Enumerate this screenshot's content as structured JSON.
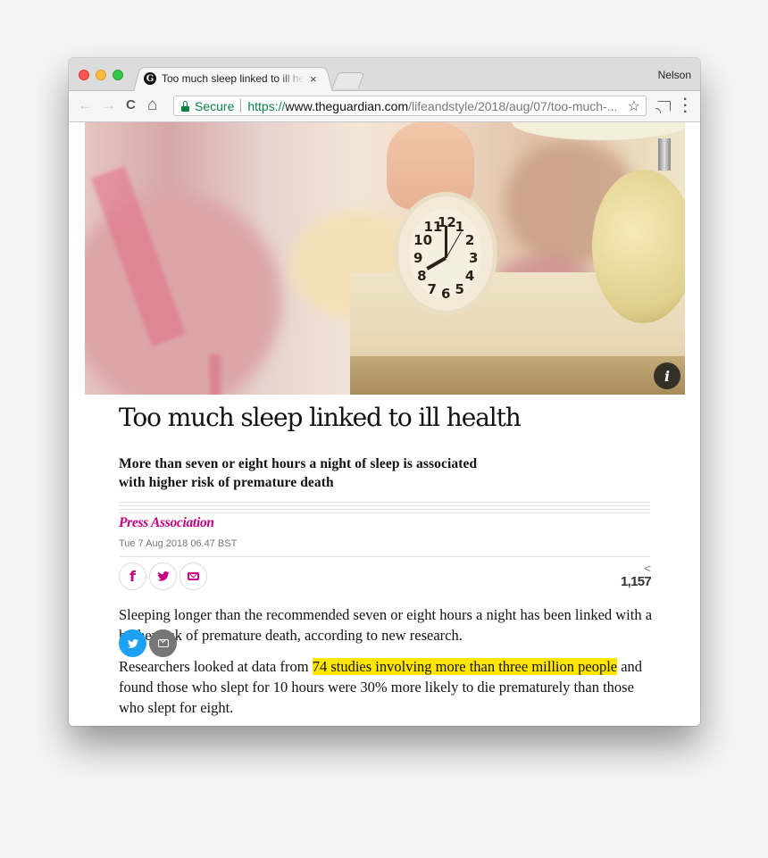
{
  "browser": {
    "tab": {
      "title": "Too much sleep linked to ill health",
      "favicon": "guardian-g-icon",
      "close_glyph": "×"
    },
    "profile_name": "Nelson",
    "nav": {
      "back_glyph": "←",
      "forward_glyph": "→",
      "reload_glyph": "C",
      "home_glyph": "⌂"
    },
    "address": {
      "security_label": "Secure",
      "scheme": "https://",
      "host": "www.theguardian.com",
      "path": "/lifeandstyle/2018/aug/07/too-much-...",
      "bookmark_glyph": "☆"
    },
    "menu_glyph": "⋮"
  },
  "hero_image": {
    "alt": "Hand pressing alarm clock on bedside table",
    "info_glyph": "i",
    "clock_numbers": [
      "12",
      "1",
      "2",
      "3",
      "4",
      "5",
      "6",
      "7",
      "8",
      "9",
      "10",
      "11"
    ]
  },
  "article": {
    "headline": "Too much sleep linked to ill health",
    "standfirst": "More than seven or eight hours a night of sleep is associated with higher risk of premature death",
    "byline": "Press Association",
    "dateline": "Tue 7 Aug 2018 06.47 BST",
    "share": {
      "facebook_glyph": "f",
      "count": "1,157",
      "share_glyph": "<"
    },
    "paragraphs": [
      {
        "text": "Sleeping longer than the recommended seven or eight hours a night has been linked with a higher risk of premature death, according to new research."
      },
      {
        "before": "Researchers looked at data from ",
        "highlight": "74 studies involving more than three million people",
        "after": " and found those who slept for 10 hours were 30% more likely to die prematurely than those who slept for eight."
      }
    ]
  },
  "colors": {
    "guardian_pink": "#c70080",
    "highlight_yellow": "#ffe500",
    "twitter_blue": "#1da1f2",
    "secure_green": "#0b8043"
  }
}
